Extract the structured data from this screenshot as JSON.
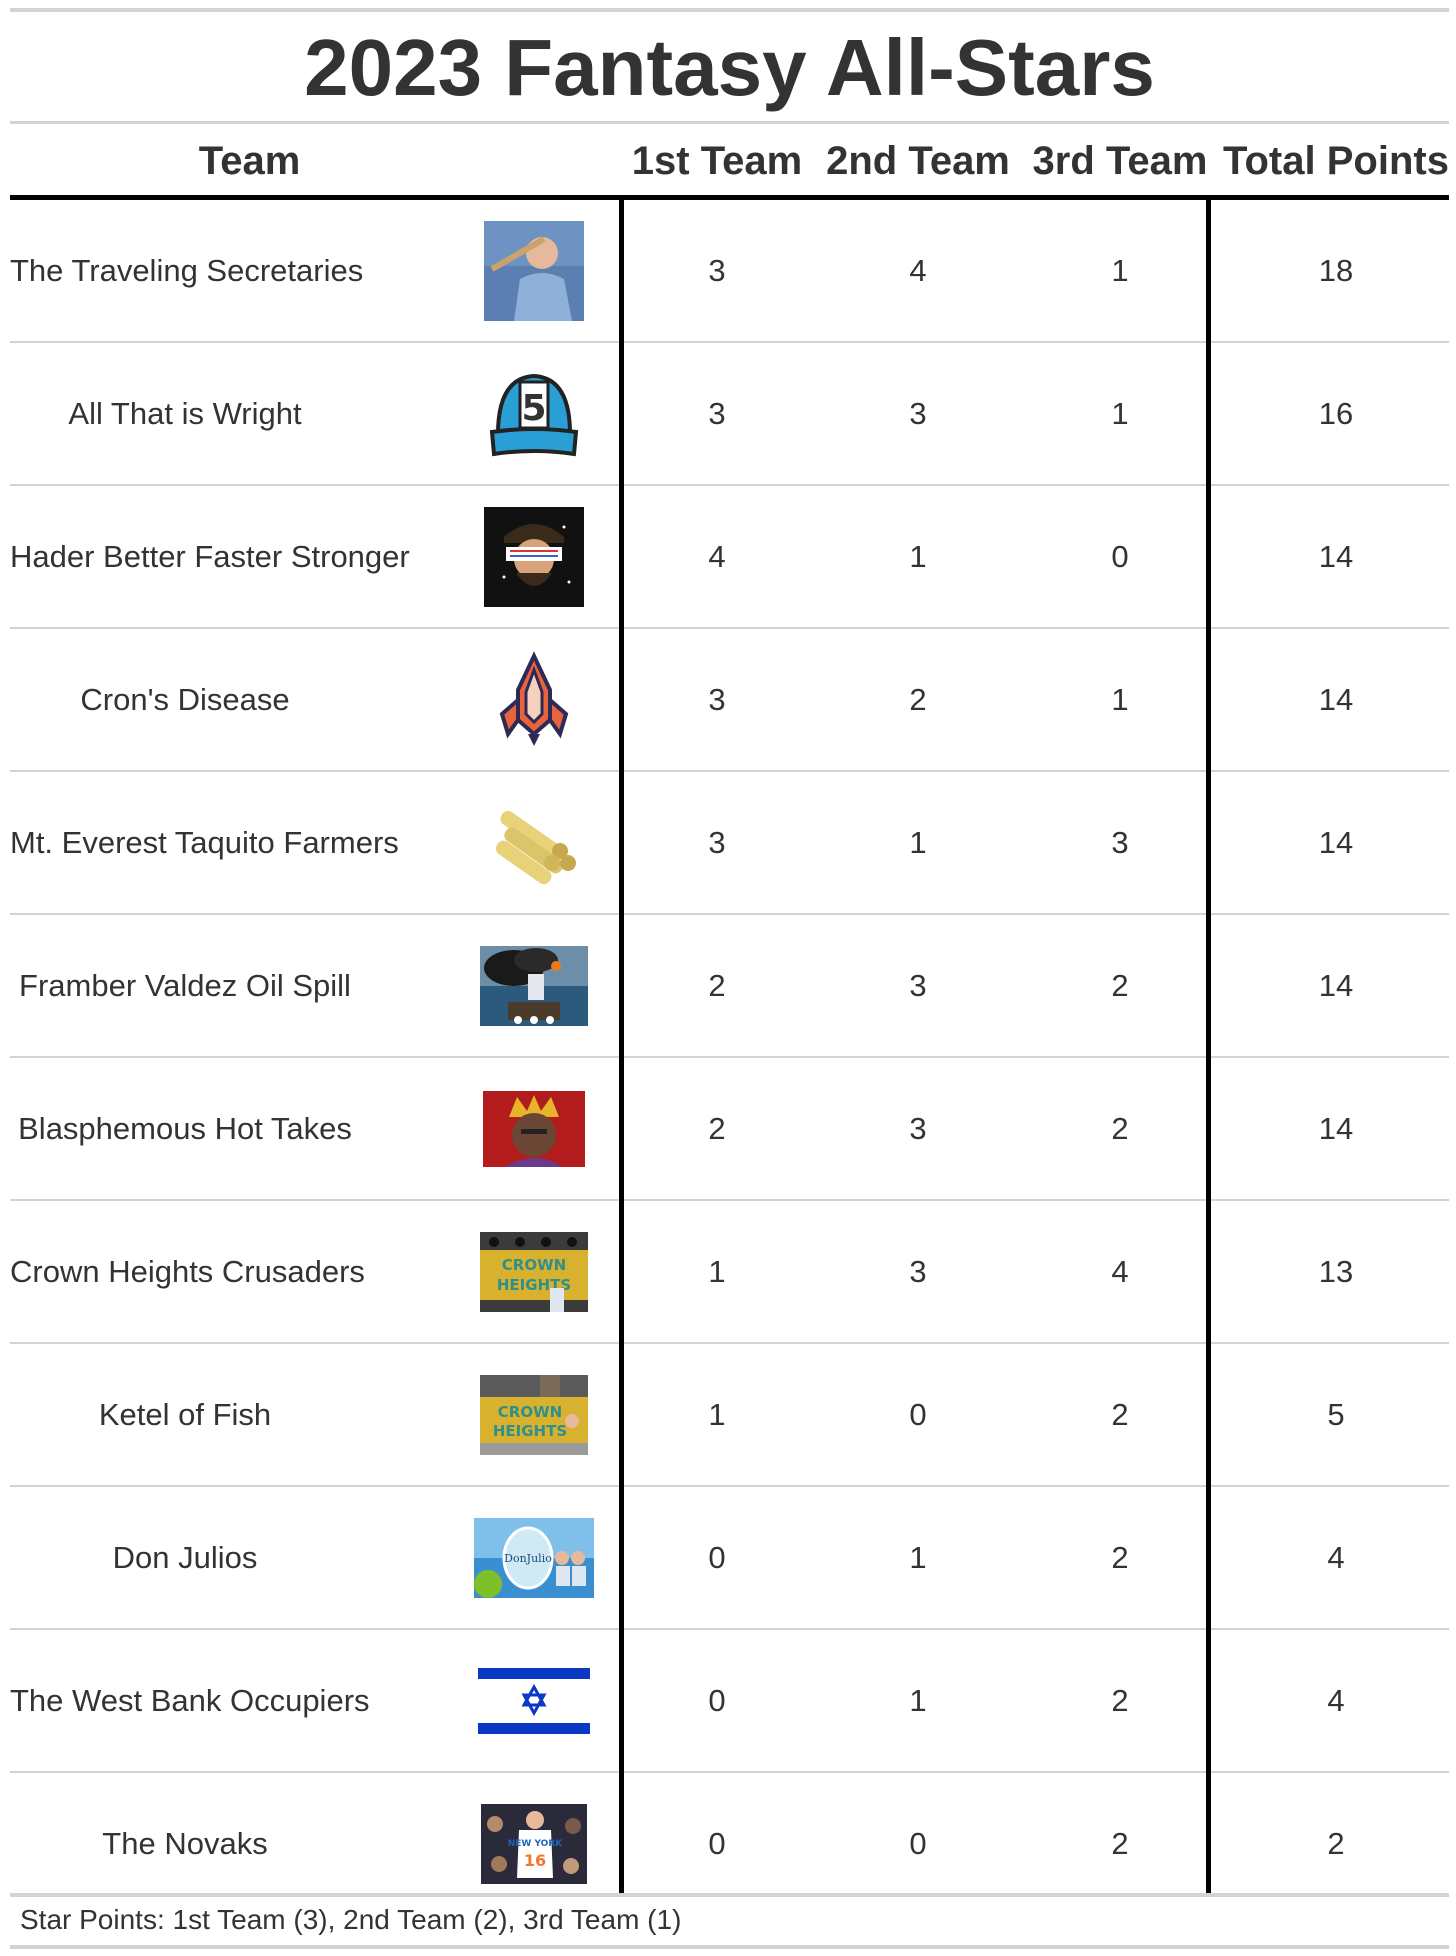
{
  "chart_data": {
    "type": "table",
    "title": "2023 Fantasy All-Stars",
    "columns": [
      "Team",
      "1st Team",
      "2nd Team",
      "3rd Team",
      "Total Points"
    ],
    "rows": [
      {
        "team": "The Traveling Secretaries",
        "first": 3,
        "second": 4,
        "third": 1,
        "total": 18,
        "logo": "baseball-batter-photo-icon"
      },
      {
        "team": "All That is Wright",
        "first": 3,
        "second": 3,
        "third": 1,
        "total": 16,
        "logo": "baseball-cap-number-5-icon"
      },
      {
        "team": "Hader Better Faster Stronger",
        "first": 4,
        "second": 1,
        "third": 0,
        "total": 14,
        "logo": "shutter-shades-pitcher-icon"
      },
      {
        "team": "Cron's Disease",
        "first": 3,
        "second": 2,
        "third": 1,
        "total": 14,
        "logo": "trident-rocket-emblem-icon"
      },
      {
        "team": "Mt. Everest Taquito Farmers",
        "first": 3,
        "second": 1,
        "third": 3,
        "total": 14,
        "logo": "taquito-stack-icon"
      },
      {
        "team": "Framber Valdez Oil Spill",
        "first": 2,
        "second": 3,
        "third": 2,
        "total": 14,
        "logo": "oil-rig-fire-icon"
      },
      {
        "team": "Blasphemous Hot Takes",
        "first": 2,
        "second": 3,
        "third": 2,
        "total": 14,
        "logo": "crowned-pundit-icon"
      },
      {
        "team": "Crown Heights Crusaders",
        "first": 1,
        "second": 3,
        "third": 4,
        "total": 13,
        "logo": "crown-heights-mural-icon"
      },
      {
        "team": "Ketel of Fish",
        "first": 1,
        "second": 0,
        "third": 2,
        "total": 5,
        "logo": "crown-heights-wall-icon"
      },
      {
        "team": "Don Julios",
        "first": 0,
        "second": 1,
        "third": 2,
        "total": 4,
        "logo": "tequila-bottle-lime-icon"
      },
      {
        "team": "The West Bank Occupiers",
        "first": 0,
        "second": 1,
        "third": 2,
        "total": 4,
        "logo": "star-of-david-flag-icon"
      },
      {
        "team": "The Novaks",
        "first": 0,
        "second": 0,
        "third": 2,
        "total": 2,
        "logo": "knicks-player-photo-icon"
      }
    ],
    "footnote": "Star Points: 1st Team (3), 2nd Team (2), 3rd Team (1)",
    "colors": {
      "text": "#333333",
      "rule": "#d3d3d3",
      "heavy_rule": "#000000"
    }
  }
}
